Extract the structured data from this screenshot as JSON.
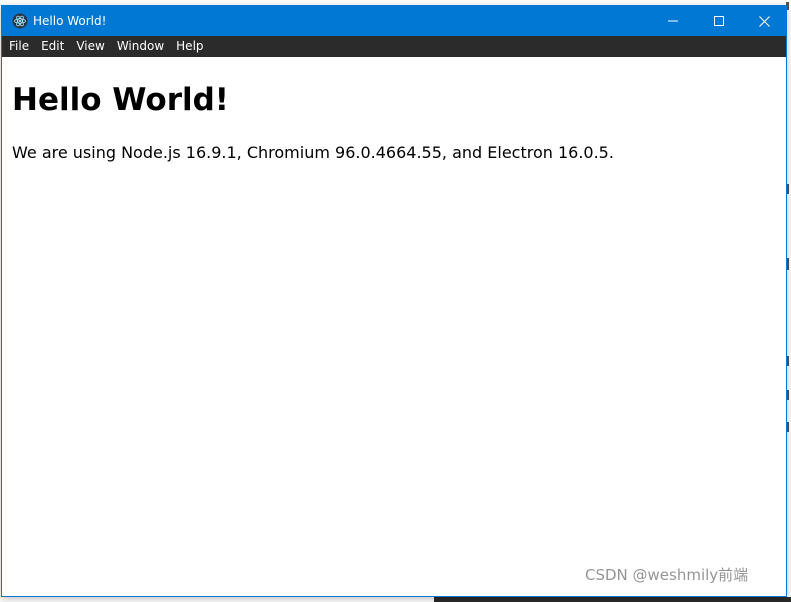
{
  "window": {
    "title": "Hello World!",
    "accent_color": "#0078d4",
    "menubar_color": "#2b2b2b",
    "icons": {
      "app": "electron-icon",
      "minimize": "minimize-icon",
      "maximize": "maximize-icon",
      "close": "close-icon"
    }
  },
  "menu": {
    "items": [
      "File",
      "Edit",
      "View",
      "Window",
      "Help"
    ]
  },
  "content": {
    "heading": "Hello World!",
    "text": "We are using Node.js 16.9.1, Chromium 96.0.4664.55, and Electron 16.0.5."
  },
  "watermark": {
    "text": "CSDN @weshmily前端"
  }
}
